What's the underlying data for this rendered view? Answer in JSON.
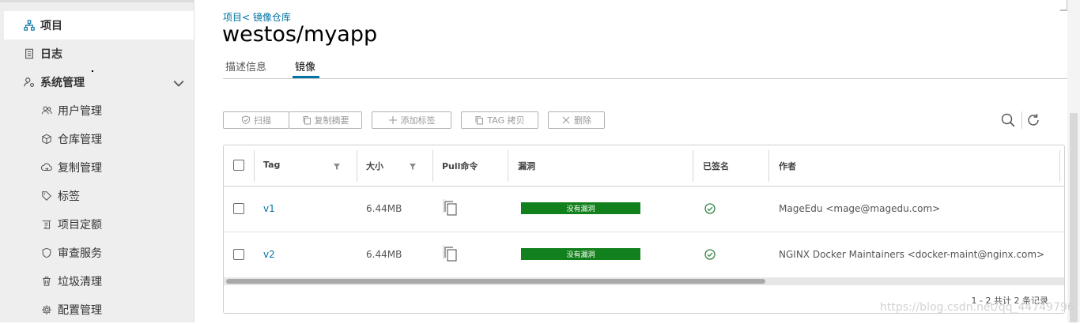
{
  "sidebar": {
    "items": [
      {
        "label": "项目",
        "icon": "project-icon",
        "level": "top",
        "active": true
      },
      {
        "label": "日志",
        "icon": "log-icon",
        "level": "top"
      },
      {
        "label": "系统管理",
        "icon": "system-admin-icon",
        "level": "top",
        "expanded": true
      },
      {
        "label": "用户管理",
        "icon": "users-icon",
        "level": "sub"
      },
      {
        "label": "仓库管理",
        "icon": "registry-icon",
        "level": "sub"
      },
      {
        "label": "复制管理",
        "icon": "replication-icon",
        "level": "sub"
      },
      {
        "label": "标签",
        "icon": "tag-icon",
        "level": "sub"
      },
      {
        "label": "项目定额",
        "icon": "quota-icon",
        "level": "sub"
      },
      {
        "label": "审查服务",
        "icon": "shield-icon",
        "level": "sub"
      },
      {
        "label": "垃圾清理",
        "icon": "trash-icon",
        "level": "sub"
      },
      {
        "label": "配置管理",
        "icon": "gear-icon",
        "level": "sub"
      }
    ]
  },
  "breadcrumb": "项目< 镜像仓库",
  "title": "westos/myapp",
  "tabs": [
    {
      "label": "描述信息"
    },
    {
      "label": "镜像",
      "active": true
    }
  ],
  "toolbar": {
    "scan": "扫描",
    "copy_digest": "复制摘要",
    "add_label": "添加标签",
    "tag_copy": "TAG 拷贝",
    "delete": "删除"
  },
  "table": {
    "headers": [
      "Tag",
      "大小",
      "Pull命令",
      "漏洞",
      "已签名",
      "作者"
    ],
    "rows": [
      {
        "tag": "v1",
        "size": "6.44MB",
        "vulnerability": "没有漏洞",
        "author": "MageEdu <mage@magedu.com>"
      },
      {
        "tag": "v2",
        "size": "6.44MB",
        "vulnerability": "没有漏洞",
        "author": "NGINX Docker Maintainers <docker-maint@nginx.com>"
      }
    ],
    "footer": "1 - 2 共计 2 条记录"
  },
  "watermark": "https://blog.csdn.net/qq_44749796",
  "colors": {
    "accent": "#0072a3",
    "vuln_ok": "#12801c",
    "signed": "#2e8540"
  }
}
